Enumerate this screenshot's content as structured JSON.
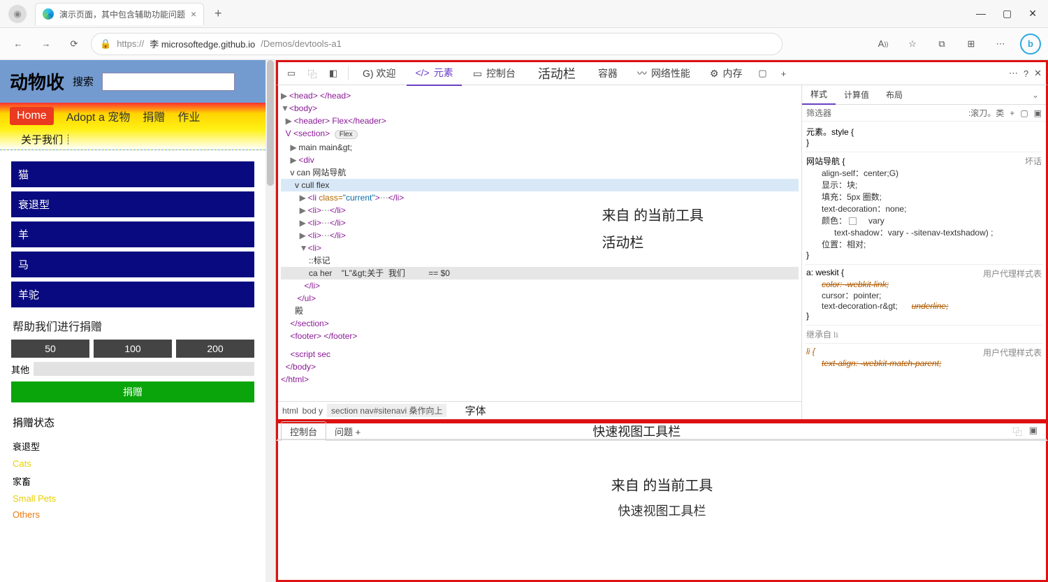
{
  "browser": {
    "tab_title": "演示页面，其中包含辅助功能问题",
    "url_prefix": "https://",
    "url_host": "李 microsoftedge.github.io",
    "url_path": "/Demos/devtools-a1",
    "font_size_label": "A",
    "bing_label": "b"
  },
  "page": {
    "title": "动物收",
    "search_label": "搜索",
    "nav": {
      "home": "Home",
      "adopt": "Adopt a 宠物",
      "donate": "捐赠",
      "jobs": "作业"
    },
    "subnav": "关于我们┊",
    "sidebar": [
      "猫",
      "衰退型",
      "羊",
      "马",
      "羊驼"
    ],
    "donate_header": "帮助我们进行捐赠",
    "donate_buttons": [
      "50",
      "100",
      "200"
    ],
    "other_label": "其他",
    "donate_go": "捐赠",
    "status_header": "捐赠状态",
    "statuses": [
      {
        "t": "衰退型"
      },
      {
        "t": "Cats",
        "cls": "y"
      },
      {
        "t": "家畜"
      },
      {
        "t": "Small Pets",
        "cls": "y"
      },
      {
        "t": "Others",
        "cls": "o"
      }
    ]
  },
  "devtools": {
    "tabs": {
      "welcome": "G) 欢迎",
      "elements": "元素",
      "console": "控制台",
      "activity": "活动栏",
      "container": "容器",
      "network": "网络性能",
      "memory": "内存"
    },
    "dom": {
      "head": "<head> </head>",
      "body_open": "<body>",
      "header_flex": "<header> Flex</header>",
      "section_open": "V <section>",
      "flex_badge": "Flex",
      "main": "main main&gt;",
      "div": "<div",
      "can_nav": "v can 网站导航",
      "cull_flex": "v cull flex",
      "li_current": "<li class=\"current\">⋯</li>",
      "li2": "<li>⋯</li>",
      "li3": "<li>⋯</li>",
      "li4": "<li>⋯</li>",
      "li5_open": "<li>",
      "marker": "::标记",
      "anchor_row": "ca her    \"L\"&gt;关于  我们          == $0",
      "li_close": "</li>",
      "ul_close": "</ul>",
      "dian": "殿",
      "section_close": "</section>",
      "footer": "<footer> </footer>",
      "script": "<script sec",
      "body_close": "</body>",
      "html_close": "</html>"
    },
    "central_annot_l1": "来自 的当前工具",
    "central_annot_l2": "活动栏",
    "breadcrumb": {
      "html": "html",
      "body": "bod     y",
      "section": "section",
      "nav": "nav#sitenavi",
      "extra": "桑作向上",
      "ziti": "字体"
    },
    "styles": {
      "tabs": {
        "styles": "样式",
        "computed": "计算值",
        "layout": "布局"
      },
      "filter": "筛选器",
      "hov": ":滚刀。类",
      "element_style": "元素。style {",
      "rule_nav_sel": "网站导航 {",
      "rule_nav_src": "坏话",
      "p_align": "align-self：center;G)",
      "p_display": "显示：块;",
      "p_padding": "填充：5px 圈数;",
      "p_textdeco": "text-decoration：none;",
      "p_color_label": "颜色：",
      "p_color_val": "vary",
      "p_textshadow": "text-shadow：vary - -sitenav-textshadow) ;",
      "p_position": "位置：相对;",
      "rule_a_sel": "a: weskit {",
      "rule_a_src": "用户代理样式表",
      "a_color": "color: -webkit-link;",
      "a_cursor": "cursor：pointer;",
      "a_tdr": "text-decoration-r&gt;",
      "a_underline": "underline;",
      "inherit": "继承自 li",
      "rule_li_sel": "li {",
      "rule_li_src": "用户代理样式表",
      "li_textalign": "text-align: -webkit-match-parent;"
    },
    "drawer": {
      "console": "控制台",
      "issues": "问题 +",
      "annot": "快速视图工具栏",
      "center_l1": "来自 的当前工具",
      "center_l2": "快速视图工具栏"
    }
  }
}
